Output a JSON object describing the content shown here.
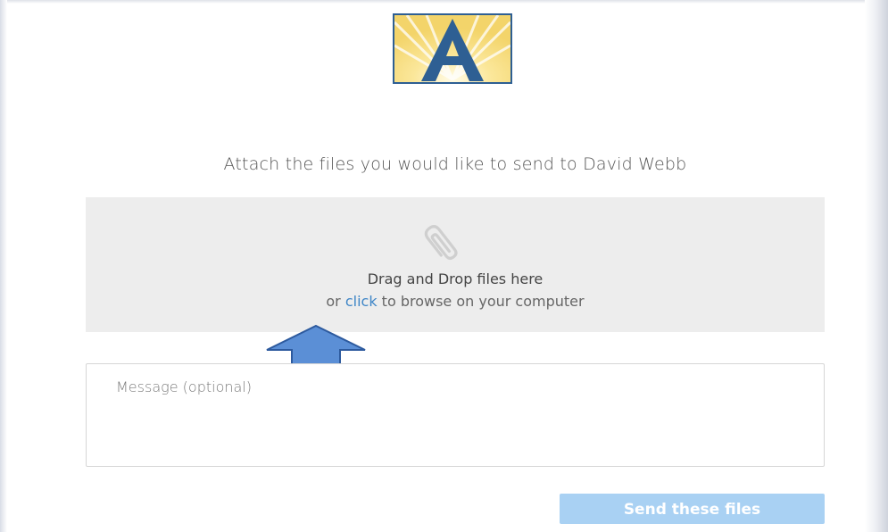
{
  "logo": {
    "letter": "A",
    "icon": "sunburst-a-logo"
  },
  "heading": "Attach the files you would like to send to David Webb",
  "dropzone": {
    "icon": "paperclip-icon",
    "title": "Drag and Drop files here",
    "sub_prefix": "or ",
    "sub_link": "click",
    "sub_suffix": " to browse on your computer"
  },
  "annotation": {
    "icon": "up-arrow-icon",
    "color": "#5b8fd6"
  },
  "message": {
    "placeholder": "Message (optional)",
    "value": ""
  },
  "send_button": {
    "label": "Send these files",
    "color": "#a9d1f3"
  },
  "colors": {
    "link": "#3f86c7",
    "dropzone_bg": "#ededed",
    "logo_border": "#2e5f93"
  }
}
